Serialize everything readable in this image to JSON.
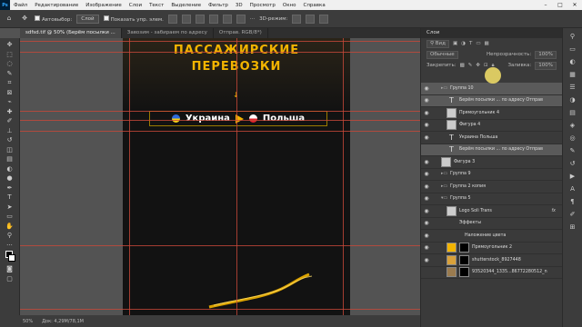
{
  "menu": {
    "items": [
      "Файл",
      "Редактирование",
      "Изображение",
      "Слои",
      "Текст",
      "Выделение",
      "Фильтр",
      "3D",
      "Просмотр",
      "Окно",
      "Справка"
    ],
    "window_controls": [
      "–",
      "□",
      "✕"
    ]
  },
  "options": {
    "autoselect_label": "Автовыбор:",
    "autoselect_value": "Слой",
    "show_controls_label": "Показать упр. элем.",
    "mode_label": "3D-режим:"
  },
  "tabs": [
    {
      "label": "sdfsd.tif @ 50% (Берём посылки ...",
      "active": true
    },
    {
      "label": "Завозим - забираем по адресу",
      "active": false
    },
    {
      "label": "Отправ. RGB/8*)",
      "active": false
    }
  ],
  "document": {
    "headline1": "ПАССАЖИРСКИЕ",
    "headline2": "ПЕРЕВОЗКИ",
    "arrow": "↓",
    "from": "Украина",
    "to": "Польша"
  },
  "status": {
    "zoom": "50%",
    "doc_info": "Док: 4,29М/78,1М"
  },
  "panel": {
    "title": "Слои",
    "kind_label": "Вид",
    "blend_mode": "Обычные",
    "opacity_label": "Непрозрачность:",
    "opacity_value": "100%",
    "lock_label": "Закрепить:",
    "fill_label": "Заливка:",
    "fill_value": "100%",
    "layers": [
      {
        "name": "Группа 10",
        "kind": "folder",
        "eye": true,
        "selected": true
      },
      {
        "name": "Берём посылки ... по адресу   Отправ",
        "kind": "text",
        "eye": true,
        "selected": true
      },
      {
        "name": "Прямоугольник 4",
        "kind": "shape",
        "eye": true,
        "selected": false
      },
      {
        "name": "Фигура 4",
        "kind": "shape",
        "eye": true,
        "selected": false
      },
      {
        "name": "Украина      Польша",
        "kind": "text",
        "eye": true,
        "selected": false
      },
      {
        "name": "Берём посылки ... по адресу   Отправ",
        "kind": "text",
        "eye": false,
        "selected": true
      },
      {
        "name": "Фигура 3",
        "kind": "shape",
        "eye": true,
        "selected": false
      },
      {
        "name": "Группа 9",
        "kind": "folder",
        "eye": true,
        "selected": false
      },
      {
        "name": "Группа 2 копия",
        "kind": "folder",
        "eye": true,
        "selected": false
      },
      {
        "name": "Группа 5",
        "kind": "folder",
        "eye": true,
        "selected": false
      },
      {
        "name": "Logo Soli Trans",
        "kind": "shape",
        "eye": true,
        "selected": false,
        "fx": "fx"
      },
      {
        "name": "Эффекты",
        "kind": "effect",
        "eye": true,
        "selected": false
      },
      {
        "name": "Наложение цвета",
        "kind": "effect",
        "eye": true,
        "selected": false
      },
      {
        "name": "Прямоугольник 2",
        "kind": "image",
        "eye": true,
        "selected": false
      },
      {
        "name": "shutterstock_8927448",
        "kind": "image",
        "eye": true,
        "selected": false
      },
      {
        "name": "93520344_1335...86772280512_n",
        "kind": "image",
        "eye": true,
        "selected": false
      }
    ]
  },
  "colors": {
    "accent": "#f2b400",
    "guide": "#c8483a",
    "panel_bg": "#3a3a3a"
  }
}
